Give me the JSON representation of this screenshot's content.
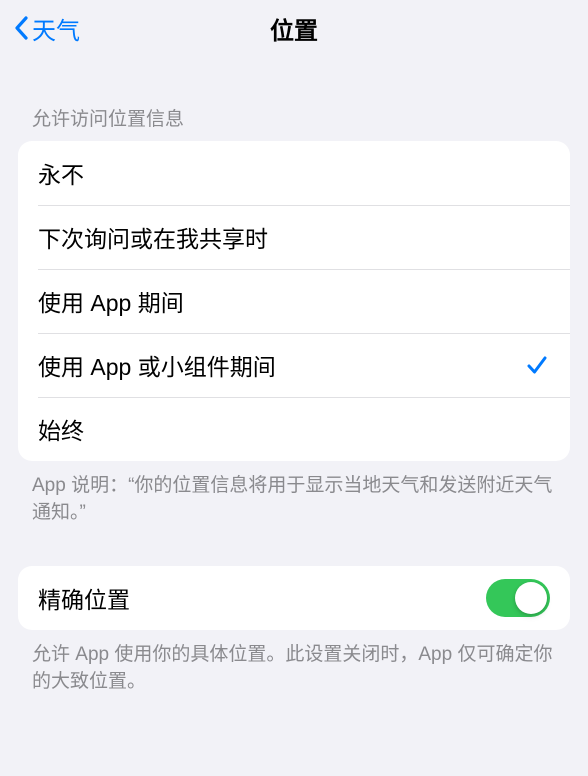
{
  "nav": {
    "back_label": "天气",
    "title": "位置"
  },
  "section_allow": {
    "header": "允许访问位置信息",
    "options": [
      {
        "label": "永不",
        "selected": false
      },
      {
        "label": "下次询问或在我共享时",
        "selected": false
      },
      {
        "label": "使用 App 期间",
        "selected": false
      },
      {
        "label": "使用 App 或小组件期间",
        "selected": true
      },
      {
        "label": "始终",
        "selected": false
      }
    ],
    "footer": "App 说明：“你的位置信息将用于显示当地天气和发送附近天气通知。”"
  },
  "section_precise": {
    "label": "精确位置",
    "enabled": true,
    "footer": "允许 App 使用你的具体位置。此设置关闭时，App 仅可确定你的大致位置。"
  },
  "colors": {
    "tint": "#007aff",
    "toggle_on": "#34c759",
    "background": "#f2f2f7"
  }
}
